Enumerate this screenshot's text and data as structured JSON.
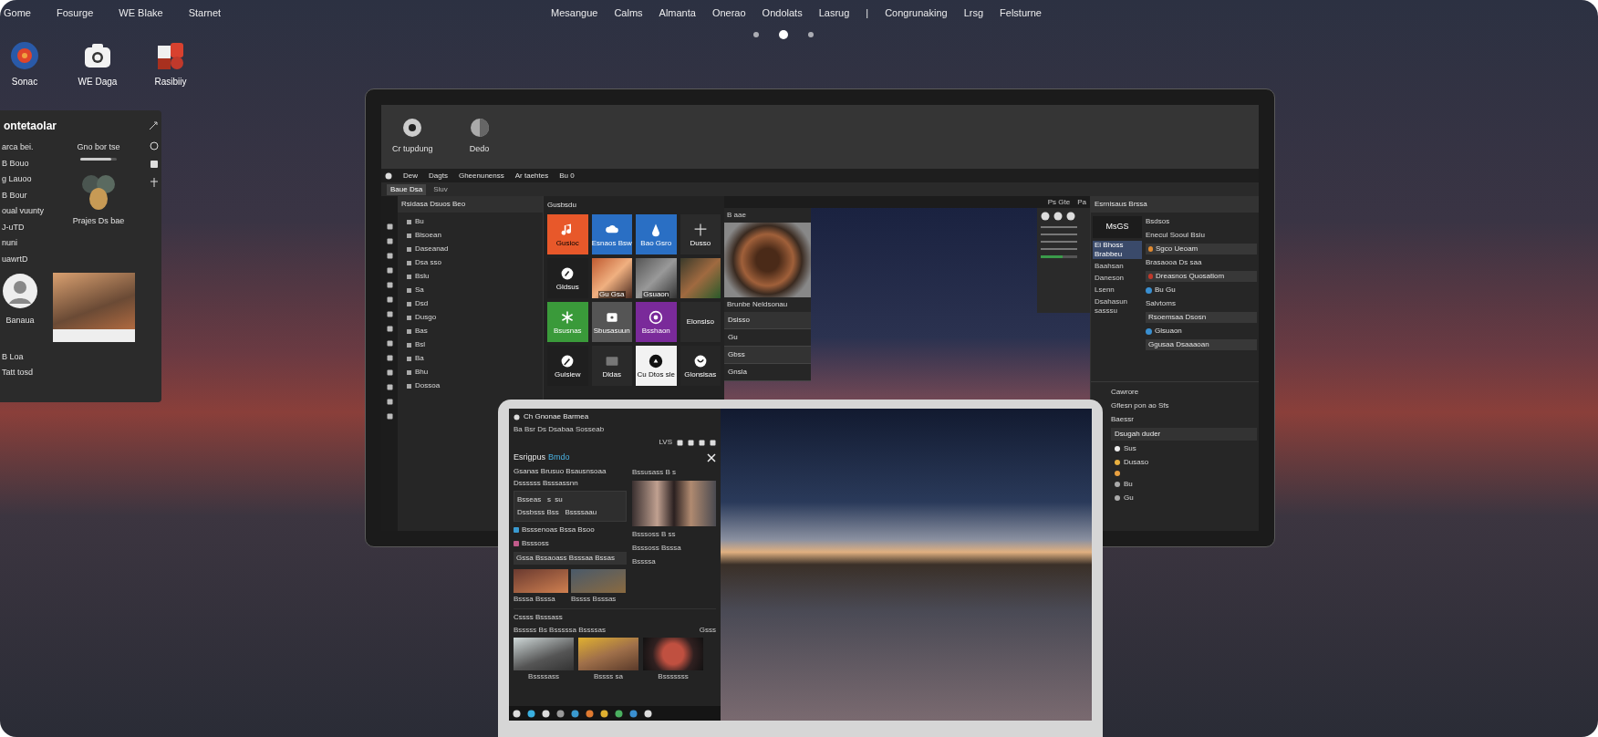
{
  "menu_left": [
    "Gome",
    "Fosurge",
    "WE Blake",
    "Starnet"
  ],
  "menu_right": [
    "Mesangue",
    "Calms",
    "Almanta",
    "Onerao",
    "Ondolats",
    "Lasrug",
    "|",
    "Congrunaking",
    "Lrsg",
    "Felsturne"
  ],
  "page_dots": [
    {
      "selected": false
    },
    {
      "selected": true
    },
    {
      "selected": false
    }
  ],
  "desktop_icons": [
    {
      "label": "Sonac"
    },
    {
      "label": "WE Daga"
    },
    {
      "label": "Rasibiiy"
    }
  ],
  "side_panel": {
    "title": "ontetaolar",
    "items": [
      "arca bei.",
      "B Bouo",
      "g Lauoo",
      "B Bour",
      "oual vuunty",
      "J-uTD",
      "nuni",
      "uawrtD"
    ],
    "widget_label": "Gno bor tse",
    "slider": {
      "level": 0.85
    },
    "blob_label": "Prajes Ds bae",
    "avatar_label": "Banaua",
    "footer_items": [
      "B Loa",
      "Tatt tosd"
    ]
  },
  "monitor": {
    "top_icons": [
      {
        "label": "Cr tupdung"
      },
      {
        "label": "Dedo"
      }
    ],
    "toolbar": [
      "Dew",
      "Dagts",
      "Gheenunenss",
      "Ar taehtes",
      "Bu 0"
    ],
    "tabs": [
      {
        "label": "Baue Dsa",
        "selected": true
      },
      {
        "label": "Sluv",
        "selected": false
      }
    ],
    "tree_header": "Rsidasa Dsuos Beo",
    "tree": [
      "Bu",
      "Bisoean",
      "Daseanad",
      "Dsa sso",
      "Bslu",
      "Sa",
      "Dsd",
      "Dusgo",
      "Bas",
      "Bsl",
      "Ba",
      "Bhu",
      "Dossoa"
    ],
    "tiles_header": "Gusbsdu",
    "tiles": [
      {
        "kind": "icon",
        "color": "#e8582a",
        "label": "Gusioc"
      },
      {
        "kind": "icon",
        "color": "#2a6fc4",
        "label": "Esnaos Bsw"
      },
      {
        "kind": "icon",
        "color": "#2a6fc4",
        "label": "Bao Gsro"
      },
      {
        "kind": "icon",
        "color": "#2b2b2b",
        "label": "Dusso"
      },
      {
        "kind": "icon",
        "color": "#1f1f1f",
        "label": "Gldsus"
      },
      {
        "kind": "photo",
        "label": "Gu Gsa"
      },
      {
        "kind": "photo",
        "label": "Gsuaon"
      },
      {
        "kind": "photo"
      },
      {
        "kind": "icon",
        "color": "#3a9a3a",
        "label": "Bsusnas"
      },
      {
        "kind": "icon",
        "color": "#555555",
        "label": "Sbusasuun"
      },
      {
        "kind": "icon",
        "color": "#7a2a9a",
        "label": "Bsshaon"
      },
      {
        "kind": "icon",
        "color": "#2b2b2b",
        "label": "Elonsiso"
      },
      {
        "kind": "icon",
        "color": "#1f1f1f",
        "label": "Guisiew"
      },
      {
        "kind": "icon",
        "color": "#2a2a2a",
        "label": "Dldas"
      },
      {
        "kind": "icon",
        "color": "#f2f2f2",
        "label": "Cu Dtos sle"
      },
      {
        "kind": "icon",
        "color": "#262626",
        "label": "Glonsisas"
      }
    ],
    "preview": {
      "header": "B aae",
      "caption": "Brunbe Neldsonau",
      "rows": [
        "Dsisso",
        "Gu",
        "Gbss",
        "Gnsla"
      ]
    },
    "photo_toolbar": [
      "Ps Gte",
      "Pa"
    ],
    "meter": {
      "level": 0.6
    },
    "settings": {
      "header": "Esrnisaus Brssa",
      "badge": "MsGS",
      "side_items": [
        {
          "label": "Ei Bhoss Brabbeu",
          "selected": true
        },
        {
          "label": "Baahsan",
          "selected": false
        },
        {
          "label": "Daneson",
          "selected": false
        },
        {
          "label": "Lsenn",
          "selected": false
        },
        {
          "label": "Dsahasun sasssu",
          "selected": false
        }
      ],
      "rows": [
        {
          "kind": "text",
          "label": "Bsdsos"
        },
        {
          "kind": "text",
          "label": "Enecul Sooul Bsiu"
        },
        {
          "kind": "field",
          "label": "Sgco Ueoam",
          "color": "#e08a30"
        },
        {
          "kind": "text",
          "label": "Brasaooa  Ds saa"
        },
        {
          "kind": "field",
          "label": "Dreasnos Quosatiom",
          "color": "#c0392b"
        },
        {
          "kind": "icon_text",
          "label": "Bu Gu",
          "color": "#3a8fd0"
        },
        {
          "kind": "text",
          "label": "Salvtoms"
        },
        {
          "kind": "field",
          "label": "Rsoemsaa Dsosn"
        },
        {
          "kind": "icon_text",
          "label": "Glsuaon",
          "color": "#3a8fd0"
        },
        {
          "kind": "field",
          "label": "Ggusaa Dsaaaoan"
        }
      ],
      "lower": [
        {
          "label": "Cawrore",
          "selected": false
        },
        {
          "label": "Gflesn pon ao Sfs",
          "selected": false
        },
        {
          "label": "Baessr",
          "selected": false
        },
        {
          "label": "Dsugah duder",
          "selected": true
        }
      ],
      "options": [
        {
          "label": "Sus",
          "color": "#eeeeee"
        },
        {
          "label": "Dusaso",
          "color": "#e8b040"
        },
        {
          "color": "#e8a040"
        },
        {
          "label": "Bu",
          "color": "#aaaaaa"
        },
        {
          "label": "Gu",
          "color": "#aaaaaa"
        }
      ]
    }
  },
  "laptop": {
    "title": "Ch Gnonae Barmea",
    "subtitle": "Ba  Bsr Ds Dsabaa Sosseab",
    "counter": "LVS",
    "heading": "Esrigpus",
    "heading_link": "Bmdo",
    "lines": [
      "Gsanas Brusuo Bsausnsoaa",
      "Dssssss Bsssassnn"
    ],
    "box_lines": [
      "Bsseas   s  su",
      "Dssbsss Bss   Bssssaau"
    ],
    "items": [
      "Bsssenoas Bssa Bsoo",
      "Bsssoss"
    ],
    "field": "Gssa Bssaoass Bsssaa Bssas",
    "photo_header": "Bssusass B s",
    "photo_captions": [
      "Bsssoss  B ss",
      "Bsssoss Bsssa",
      "Bssssa"
    ],
    "thumbs": [
      "Bsssa Bsssa",
      "Bssss Bsssas"
    ],
    "section": "Cssss Bsssass",
    "section_sub": "Bsssss Bs Bsssssa Bssssas",
    "section_side": "Gsss",
    "gallery": [
      "Bssssass",
      "Bssss sa",
      "Bsssssss"
    ]
  }
}
